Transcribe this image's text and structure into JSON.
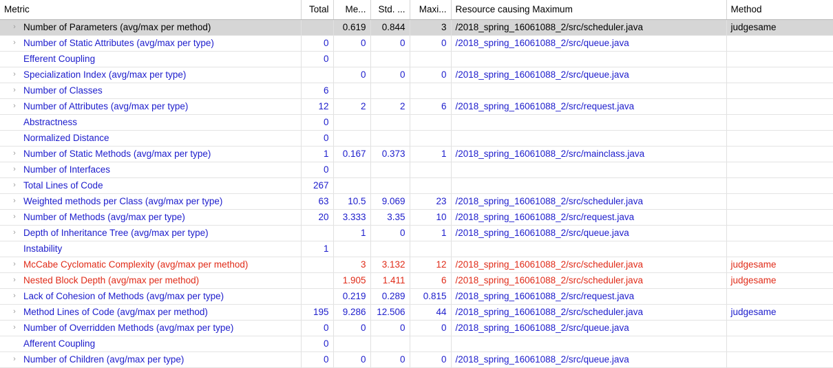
{
  "table": {
    "columns": [
      {
        "key": "metric",
        "label": "Metric",
        "align": "left"
      },
      {
        "key": "total",
        "label": "Total",
        "align": "right"
      },
      {
        "key": "mean",
        "label": "Me...",
        "align": "right"
      },
      {
        "key": "std",
        "label": "Std. ...",
        "align": "right"
      },
      {
        "key": "max",
        "label": "Maxi...",
        "align": "right"
      },
      {
        "key": "resource",
        "label": "Resource causing Maximum",
        "align": "left"
      },
      {
        "key": "method",
        "label": "Method",
        "align": "left"
      }
    ],
    "colors": {
      "normal_text": "#1c1ccc",
      "warning_text": "#e02b18",
      "selected_text": "#000000",
      "selected_row_bg": "#d6d6d6",
      "header_text": "#000000",
      "grid_line": "#e0e0e0",
      "chevron": "#9a9a9a"
    },
    "rows": [
      {
        "expandable": true,
        "state": "selected",
        "color": "black",
        "metric": "Number of Parameters (avg/max per method)",
        "total": "",
        "mean": "0.619",
        "std": "0.844",
        "max": "3",
        "resource": "/2018_spring_16061088_2/src/scheduler.java",
        "method": "judgesame"
      },
      {
        "expandable": true,
        "state": "normal",
        "color": "blue",
        "metric": "Number of Static Attributes (avg/max per type)",
        "total": "0",
        "mean": "0",
        "std": "0",
        "max": "0",
        "resource": "/2018_spring_16061088_2/src/queue.java",
        "method": ""
      },
      {
        "expandable": false,
        "state": "normal",
        "color": "blue",
        "metric": "Efferent Coupling",
        "total": "0",
        "mean": "",
        "std": "",
        "max": "",
        "resource": "",
        "method": ""
      },
      {
        "expandable": true,
        "state": "normal",
        "color": "blue",
        "metric": "Specialization Index (avg/max per type)",
        "total": "",
        "mean": "0",
        "std": "0",
        "max": "0",
        "resource": "/2018_spring_16061088_2/src/queue.java",
        "method": ""
      },
      {
        "expandable": true,
        "state": "normal",
        "color": "blue",
        "metric": "Number of Classes",
        "total": "6",
        "mean": "",
        "std": "",
        "max": "",
        "resource": "",
        "method": ""
      },
      {
        "expandable": true,
        "state": "normal",
        "color": "blue",
        "metric": "Number of Attributes (avg/max per type)",
        "total": "12",
        "mean": "2",
        "std": "2",
        "max": "6",
        "resource": "/2018_spring_16061088_2/src/request.java",
        "method": ""
      },
      {
        "expandable": false,
        "state": "normal",
        "color": "blue",
        "metric": "Abstractness",
        "total": "0",
        "mean": "",
        "std": "",
        "max": "",
        "resource": "",
        "method": ""
      },
      {
        "expandable": false,
        "state": "normal",
        "color": "blue",
        "metric": "Normalized Distance",
        "total": "0",
        "mean": "",
        "std": "",
        "max": "",
        "resource": "",
        "method": ""
      },
      {
        "expandable": true,
        "state": "normal",
        "color": "blue",
        "metric": "Number of Static Methods (avg/max per type)",
        "total": "1",
        "mean": "0.167",
        "std": "0.373",
        "max": "1",
        "resource": "/2018_spring_16061088_2/src/mainclass.java",
        "method": ""
      },
      {
        "expandable": true,
        "state": "normal",
        "color": "blue",
        "metric": "Number of Interfaces",
        "total": "0",
        "mean": "",
        "std": "",
        "max": "",
        "resource": "",
        "method": ""
      },
      {
        "expandable": true,
        "state": "normal",
        "color": "blue",
        "metric": "Total Lines of Code",
        "total": "267",
        "mean": "",
        "std": "",
        "max": "",
        "resource": "",
        "method": ""
      },
      {
        "expandable": true,
        "state": "normal",
        "color": "blue",
        "metric": "Weighted methods per Class (avg/max per type)",
        "total": "63",
        "mean": "10.5",
        "std": "9.069",
        "max": "23",
        "resource": "/2018_spring_16061088_2/src/scheduler.java",
        "method": ""
      },
      {
        "expandable": true,
        "state": "normal",
        "color": "blue",
        "metric": "Number of Methods (avg/max per type)",
        "total": "20",
        "mean": "3.333",
        "std": "3.35",
        "max": "10",
        "resource": "/2018_spring_16061088_2/src/request.java",
        "method": ""
      },
      {
        "expandable": true,
        "state": "normal",
        "color": "blue",
        "metric": "Depth of Inheritance Tree (avg/max per type)",
        "total": "",
        "mean": "1",
        "std": "0",
        "max": "1",
        "resource": "/2018_spring_16061088_2/src/queue.java",
        "method": ""
      },
      {
        "expandable": false,
        "state": "normal",
        "color": "blue",
        "metric": "Instability",
        "total": "1",
        "mean": "",
        "std": "",
        "max": "",
        "resource": "",
        "method": ""
      },
      {
        "expandable": true,
        "state": "warning",
        "color": "red",
        "metric": "McCabe Cyclomatic Complexity (avg/max per method)",
        "total": "",
        "mean": "3",
        "std": "3.132",
        "max": "12",
        "resource": "/2018_spring_16061088_2/src/scheduler.java",
        "method": "judgesame"
      },
      {
        "expandable": true,
        "state": "warning",
        "color": "red",
        "metric": "Nested Block Depth (avg/max per method)",
        "total": "",
        "mean": "1.905",
        "std": "1.411",
        "max": "6",
        "resource": "/2018_spring_16061088_2/src/scheduler.java",
        "method": "judgesame"
      },
      {
        "expandable": true,
        "state": "normal",
        "color": "blue",
        "metric": "Lack of Cohesion of Methods (avg/max per type)",
        "total": "",
        "mean": "0.219",
        "std": "0.289",
        "max": "0.815",
        "resource": "/2018_spring_16061088_2/src/request.java",
        "method": ""
      },
      {
        "expandable": true,
        "state": "normal",
        "color": "blue",
        "metric": "Method Lines of Code (avg/max per method)",
        "total": "195",
        "mean": "9.286",
        "std": "12.506",
        "max": "44",
        "resource": "/2018_spring_16061088_2/src/scheduler.java",
        "method": "judgesame"
      },
      {
        "expandable": true,
        "state": "normal",
        "color": "blue",
        "metric": "Number of Overridden Methods (avg/max per type)",
        "total": "0",
        "mean": "0",
        "std": "0",
        "max": "0",
        "resource": "/2018_spring_16061088_2/src/queue.java",
        "method": ""
      },
      {
        "expandable": false,
        "state": "normal",
        "color": "blue",
        "metric": "Afferent Coupling",
        "total": "0",
        "mean": "",
        "std": "",
        "max": "",
        "resource": "",
        "method": ""
      },
      {
        "expandable": true,
        "state": "normal",
        "color": "blue",
        "metric": "Number of Children (avg/max per type)",
        "total": "0",
        "mean": "0",
        "std": "0",
        "max": "0",
        "resource": "/2018_spring_16061088_2/src/queue.java",
        "method": ""
      }
    ],
    "chevron_glyph": "›"
  }
}
